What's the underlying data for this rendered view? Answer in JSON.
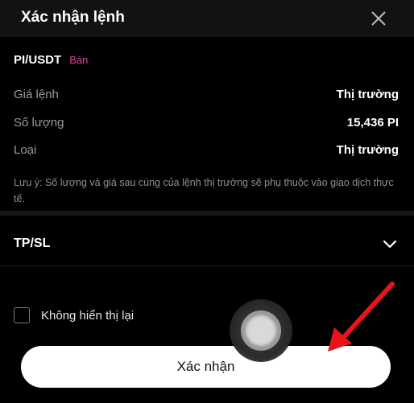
{
  "dialog": {
    "title": "Xác nhận lệnh"
  },
  "order": {
    "pair": "PI/USDT",
    "side": "Bán",
    "side_color": "#e0409c",
    "rows": [
      {
        "label": "Giá lệnh",
        "value": "Thị trường"
      },
      {
        "label": "Số lượng",
        "value": "15,436 PI"
      },
      {
        "label": "Loại",
        "value": "Thị trường"
      }
    ],
    "note": "Lưu ý: Số lượng và giá sau cùng của lệnh thị trường sẽ phụ thuộc vào giao dịch thực tế."
  },
  "tpsl": {
    "label": "TP/SL"
  },
  "dont_show": {
    "label": "Không hiển thị lại"
  },
  "confirm": {
    "label": "Xác nhận"
  },
  "icons": {
    "close": "close-icon",
    "chevron": "chevron-down-icon",
    "arrow": "red-arrow-annotation"
  },
  "colors": {
    "accent_red": "#e8141b",
    "button_bg": "#ffffff"
  }
}
